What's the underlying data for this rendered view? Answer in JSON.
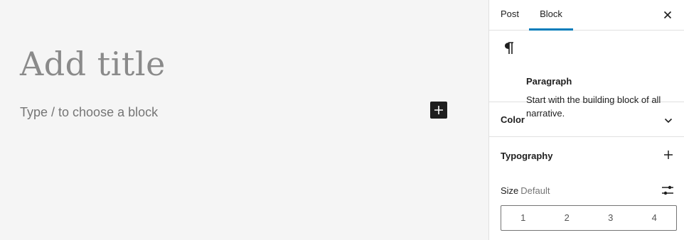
{
  "editor": {
    "title_placeholder": "Add title",
    "block_placeholder": "Type / to choose a block",
    "inserter_icon": "plus-icon"
  },
  "sidebar": {
    "tabs": [
      {
        "label": "Post",
        "active": false
      },
      {
        "label": "Block",
        "active": true
      }
    ],
    "close_icon": "close-icon",
    "accent_color": "#007cba",
    "block": {
      "icon": "paragraph-icon",
      "name": "Paragraph",
      "description": "Start with the building block of all narrative."
    },
    "panels": {
      "color": {
        "title": "Color",
        "toggle_icon": "chevron-down-icon"
      },
      "typography": {
        "title": "Typography",
        "toggle_icon": "plus-icon",
        "size_label": "Size",
        "size_value": "Default",
        "size_options_icon": "sliders-icon",
        "size_options": [
          "1",
          "2",
          "3",
          "4"
        ]
      }
    }
  }
}
